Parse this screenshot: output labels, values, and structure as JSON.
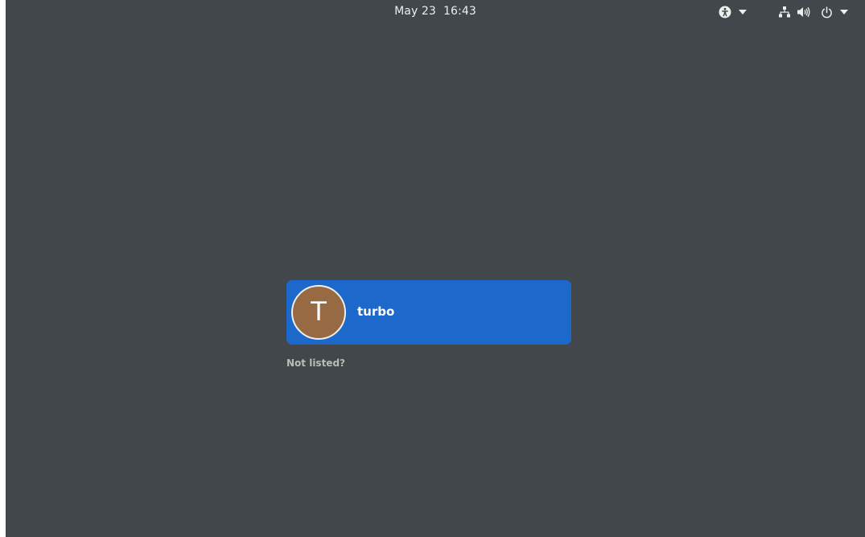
{
  "topbar": {
    "date": "May 23",
    "time": "16:43",
    "icons": {
      "accessibility": "accessibility-icon",
      "accessibility_menu": "chevron-down-icon",
      "network": "network-wired-icon",
      "volume": "volume-icon",
      "power": "power-icon",
      "system_menu": "chevron-down-icon"
    }
  },
  "login": {
    "user": {
      "initial": "T",
      "name": "turbo",
      "avatar_color": "#986a44"
    },
    "not_listed_label": "Not listed?"
  },
  "colors": {
    "background": "#41474b",
    "selection": "#1c69cb",
    "text": "#eeeeec",
    "muted_text": "#babdb6"
  }
}
